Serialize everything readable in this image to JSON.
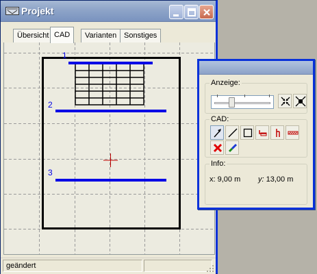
{
  "window": {
    "title": "Projekt",
    "buttons": [
      "minimize",
      "maximize",
      "close"
    ],
    "icon": "window-app-icon"
  },
  "tabs": [
    {
      "label": "Übersicht",
      "active": false
    },
    {
      "label": "CAD",
      "active": true
    },
    {
      "label": "Varianten",
      "active": false
    },
    {
      "label": "Sonstiges",
      "active": false
    }
  ],
  "canvas": {
    "labels": [
      "1",
      "2",
      "3"
    ],
    "colors": {
      "line": "#0000e6",
      "frame": "#000000",
      "grid": "#9a9a9a",
      "cross": "#c00000",
      "bg": "#ecebe0"
    }
  },
  "status": {
    "text": "geändert"
  },
  "palette": {
    "anzeige": {
      "label": "Anzeige:",
      "zoom_in_icon": "zoom-in-icon",
      "zoom_out_icon": "zoom-out-icon"
    },
    "cad": {
      "label": "CAD:",
      "tools": [
        "select-arrow-icon",
        "line-icon",
        "rectangle-icon",
        "wall-end-icon",
        "door-icon",
        "window-hatch-icon",
        "delete-icon",
        "edit-color-icon"
      ]
    },
    "info": {
      "label": "Info:",
      "x_prefix": "x:",
      "x_value": "9,00 m",
      "y_prefix": "y:",
      "y_value": "13,00 m"
    }
  }
}
